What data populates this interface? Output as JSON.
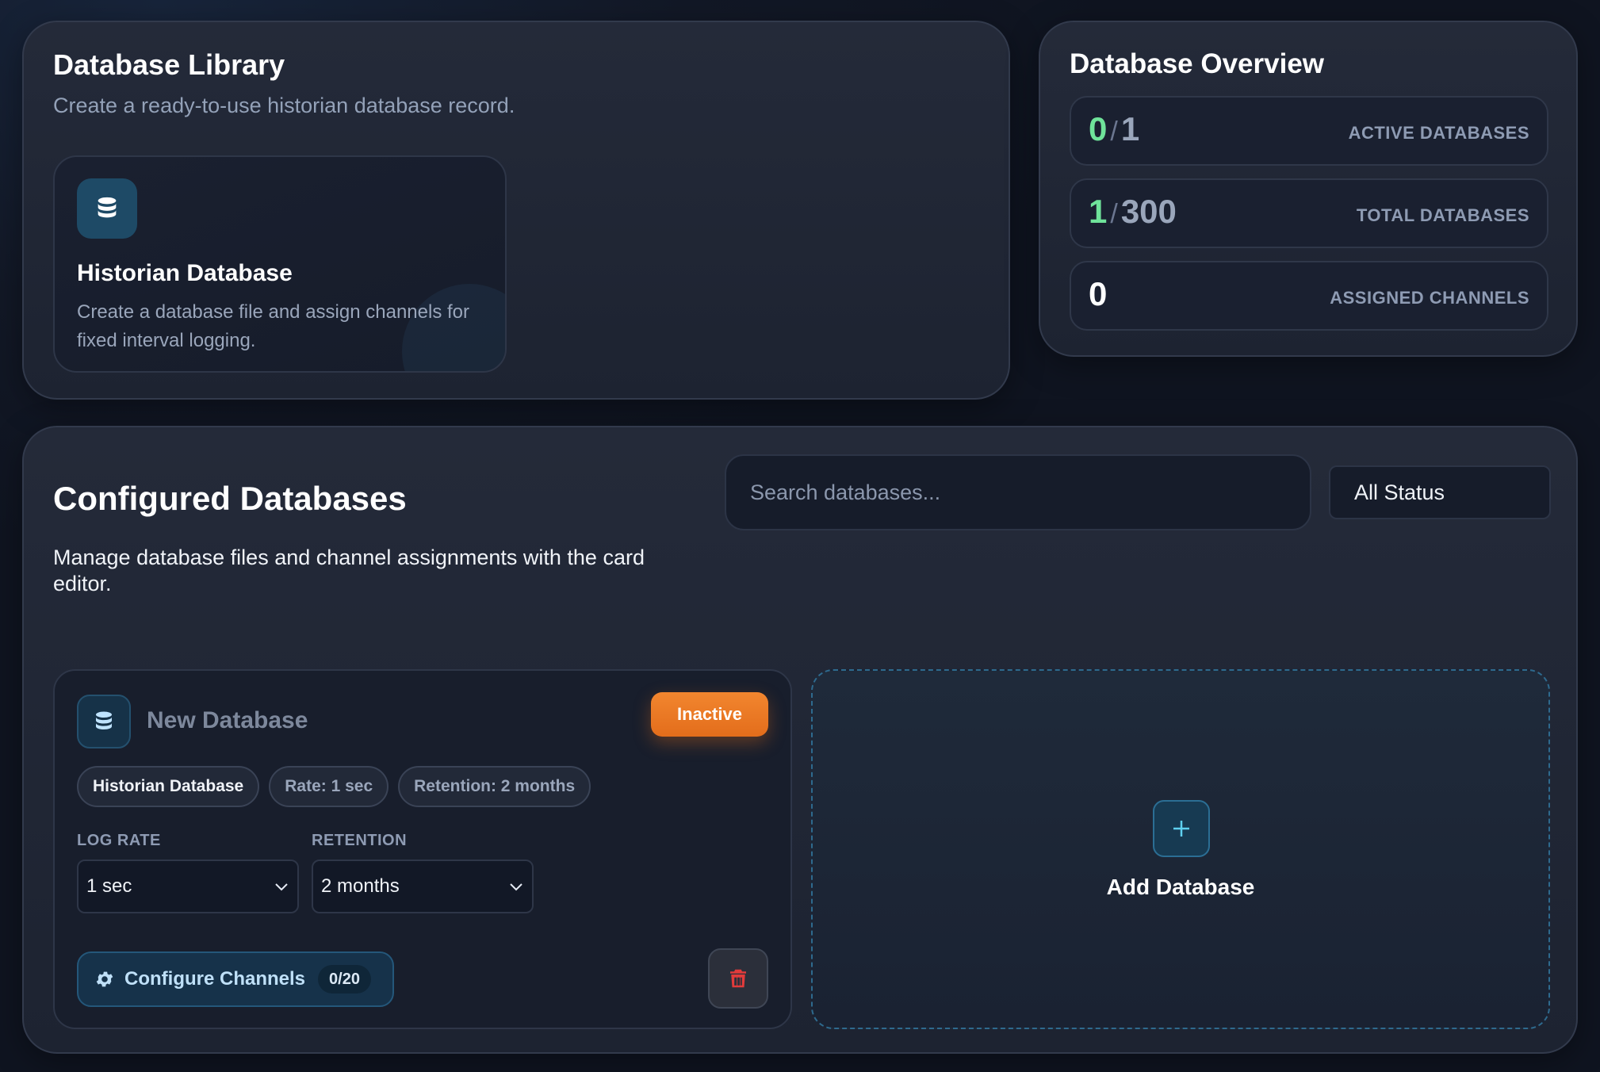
{
  "library": {
    "title": "Database Library",
    "subtitle": "Create a ready-to-use historian database record.",
    "template": {
      "title": "Historian Database",
      "description": "Create a database file and assign channels for fixed interval logging.",
      "icon": "database-icon"
    }
  },
  "overview": {
    "title": "Database Overview",
    "stats": [
      {
        "value": "0",
        "total": "1",
        "label": "ACTIVE DATABASES"
      },
      {
        "value": "1",
        "total": "300",
        "label": "TOTAL DATABASES"
      },
      {
        "value": "0",
        "label": "ASSIGNED CHANNELS"
      }
    ]
  },
  "configured": {
    "title": "Configured Databases",
    "subtitle": "Manage database files and channel assignments with the card editor.",
    "search_placeholder": "Search databases...",
    "status_filter": "All Status",
    "databases": [
      {
        "name": "New Database",
        "status": "Inactive",
        "chips": [
          "Historian Database",
          "Rate: 1 sec",
          "Retention: 2 months"
        ],
        "log_rate_label": "LOG RATE",
        "log_rate": "1 sec",
        "retention_label": "RETENTION",
        "retention": "2 months",
        "configure_label": "Configure Channels",
        "channel_count": "0/20"
      }
    ],
    "add_label": "Add Database"
  },
  "colors": {
    "accent_green": "#6fe39a",
    "inactive_orange": "#ec7a24",
    "accent_blue": "#2e6a8e",
    "delete_red": "#e23b3b"
  }
}
